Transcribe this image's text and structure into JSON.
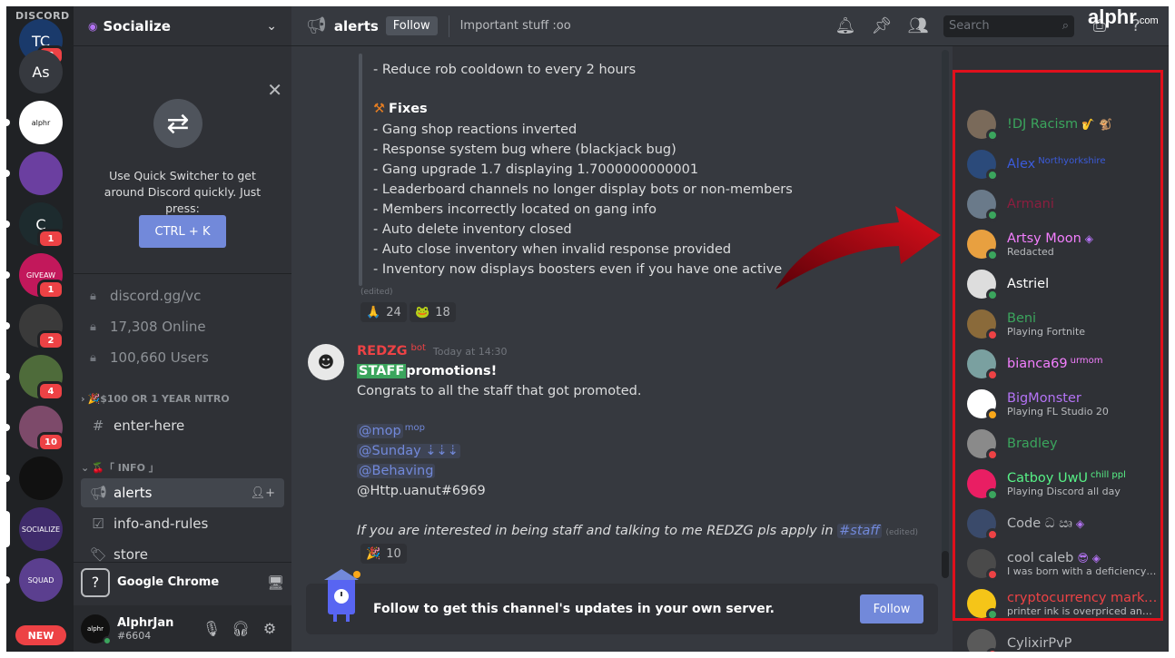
{
  "watermark": {
    "brand": "alphr",
    "suffix": ".com"
  },
  "rail": {
    "wordmark": "DISCORD",
    "servers": [
      {
        "id": "tc",
        "label": "TC",
        "badge": "2",
        "color": "#1a3a6b"
      },
      {
        "id": "as",
        "label": "As",
        "badge": "",
        "color": "#36393f"
      },
      {
        "id": "alphr",
        "label": "alphr",
        "badge": "",
        "color": "#ffffff"
      },
      {
        "id": "purple",
        "label": "",
        "badge": "",
        "color": "#6b3fa0"
      },
      {
        "id": "c",
        "label": "C",
        "badge": "1",
        "color": "#1d2b2e"
      },
      {
        "id": "giveaway",
        "label": "GIVEAW",
        "badge": "1",
        "color": "#c2185b"
      },
      {
        "id": "night",
        "label": "",
        "badge": "2",
        "color": "#3a3a3a"
      },
      {
        "id": "char",
        "label": "",
        "badge": "4",
        "color": "#4e6b3a"
      },
      {
        "id": "glasses",
        "label": "",
        "badge": "10",
        "color": "#7d4a6a"
      },
      {
        "id": "na",
        "label": "",
        "badge": "",
        "color": "#111111"
      },
      {
        "id": "socialize",
        "label": "SOCIALIZE",
        "badge": "",
        "color": "#3f2b6b"
      },
      {
        "id": "squad",
        "label": "SQUAD",
        "badge": "",
        "color": "#5b3f8f"
      }
    ],
    "new_label": "NEW"
  },
  "sidebar": {
    "guild_name": "Socialize",
    "quick_switcher": {
      "text": "Use Quick Switcher to get around Discord quickly. Just press:",
      "button": "CTRL + K"
    },
    "info": [
      "discord.gg/vc",
      "17,308 Online",
      "100,660 Users"
    ],
    "categories": [
      {
        "label": "$100 OR 1 YEAR NITRO",
        "emoji": "🎉"
      },
      {
        "label": "「 INFO 」",
        "emoji": "🍒"
      }
    ],
    "channels": {
      "enter_here": "enter-here",
      "alerts": "alerts",
      "info_rules": "info-and-rules",
      "store": "store"
    },
    "activity": "Google Chrome",
    "user": {
      "name": "AlphrJan",
      "tag": "#6604",
      "avatar_text": "alphr"
    }
  },
  "topbar": {
    "channel": "alerts",
    "follow": "Follow",
    "topic": "Important stuff :oo",
    "search_placeholder": "Search"
  },
  "messages": {
    "top_line": "- Reduce rob cooldown to every 2 hours",
    "fixes_title": "Fixes",
    "fixes_emoji": "⚒",
    "fixes": [
      "- Gang shop reactions inverted",
      "- Response system bug where (blackjack bug)",
      "- Gang upgrade 1.7 displaying 1.7000000000001",
      "- Leaderboard channels no longer display bots or non-members",
      "- Members incorrectly located on gang info",
      "- Auto delete inventory closed",
      "- Auto close inventory when invalid response provided",
      "- Inventory now displays boosters even if you have one active"
    ],
    "edited": "(edited)",
    "reactions1": [
      {
        "emoji": "🙏",
        "count": "24"
      },
      {
        "emoji": "🐸",
        "count": "18"
      }
    ],
    "second": {
      "author": "REDZG",
      "bot_tag": "bot",
      "timestamp": "Today at 14:30",
      "staff_tag": "STAFF",
      "headline": "promotions!",
      "line1": "Congrats to all the staff that got promoted.",
      "mentions": [
        {
          "text": "@mop",
          "sup": "mop"
        },
        {
          "text": "@Sunday ⇣⇣⇣",
          "sup": ""
        },
        {
          "text": "@Behaving",
          "sup": ""
        }
      ],
      "plain_mention": "@Http.uanut#6969",
      "closing": "If you are interested in being staff and talking to me REDZG pls apply in",
      "closing_channel": "#staff",
      "reaction": {
        "emoji": "🎉",
        "count": "10"
      }
    }
  },
  "follow_bar": {
    "text": "Follow to get this channel's updates in your own server.",
    "button": "Follow"
  },
  "members": [
    {
      "name": "!DJ Racism",
      "extra": "🎷 🐒",
      "sup": "",
      "sub": "",
      "color": "#3ba55d",
      "status": "online",
      "av": "#7a6a5a"
    },
    {
      "name": "Alex",
      "extra": "",
      "sup": "Northyorkshire",
      "sub": "",
      "color": "#3b5bdb",
      "status": "online",
      "av": "#2b4a7a"
    },
    {
      "name": "Armani",
      "extra": "",
      "sup": "",
      "sub": "",
      "color": "#8b1e3f",
      "status": "online",
      "av": "#6a7a8a"
    },
    {
      "name": "Artsy Moon",
      "extra": "◈",
      "sup": "",
      "sub": "Redacted",
      "color": "#f47fff",
      "status": "online",
      "av": "#e8a040"
    },
    {
      "name": "Astriel",
      "extra": "",
      "sup": "",
      "sub": "",
      "color": "#ffffff",
      "status": "online",
      "av": "#dddddd"
    },
    {
      "name": "Beni",
      "extra": "",
      "sup": "",
      "sub": "Playing Fortnite",
      "color": "#3ba55d",
      "status": "dnd",
      "av": "#8a6a3a"
    },
    {
      "name": "bianca69",
      "extra": "",
      "sup": "urmom",
      "sub": "",
      "color": "#f47fff",
      "status": "dnd",
      "av": "#7aa0a0"
    },
    {
      "name": "BigMonster",
      "extra": "",
      "sup": "",
      "sub": "Playing FL Studio 20",
      "color": "#b473f5",
      "status": "idle",
      "av": "#ffffff"
    },
    {
      "name": "Bradley",
      "extra": "",
      "sup": "",
      "sub": "",
      "color": "#3ba55d",
      "status": "dnd",
      "av": "#8a8a8a"
    },
    {
      "name": "Catboy UwU",
      "extra": "",
      "sup": "chill ppl",
      "sub": "Playing Discord all day",
      "color": "#57f287",
      "status": "online",
      "av": "#e91e63"
    },
    {
      "name": "Code ධ ඍ",
      "extra": "◈",
      "sup": "",
      "sub": "",
      "color": "#b9bbbe",
      "status": "dnd",
      "av": "#3a4a6a"
    },
    {
      "name": "cool caleb",
      "extra": "😎 ◈",
      "sup": "",
      "sub": "I was born with a deficiency ...",
      "color": "#b9bbbe",
      "status": "dnd",
      "av": "#4a4a4a"
    },
    {
      "name": "cryptocurrency marke...",
      "extra": "",
      "sup": "",
      "sub": "printer ink is overpriced and a ...",
      "color": "#ed4245",
      "status": "online",
      "av": "#f5c518"
    },
    {
      "name": "CylixirPvP",
      "extra": "",
      "sup": "",
      "sub": "",
      "color": "#b9bbbe",
      "status": "dnd",
      "av": "#5a5a5a"
    }
  ]
}
